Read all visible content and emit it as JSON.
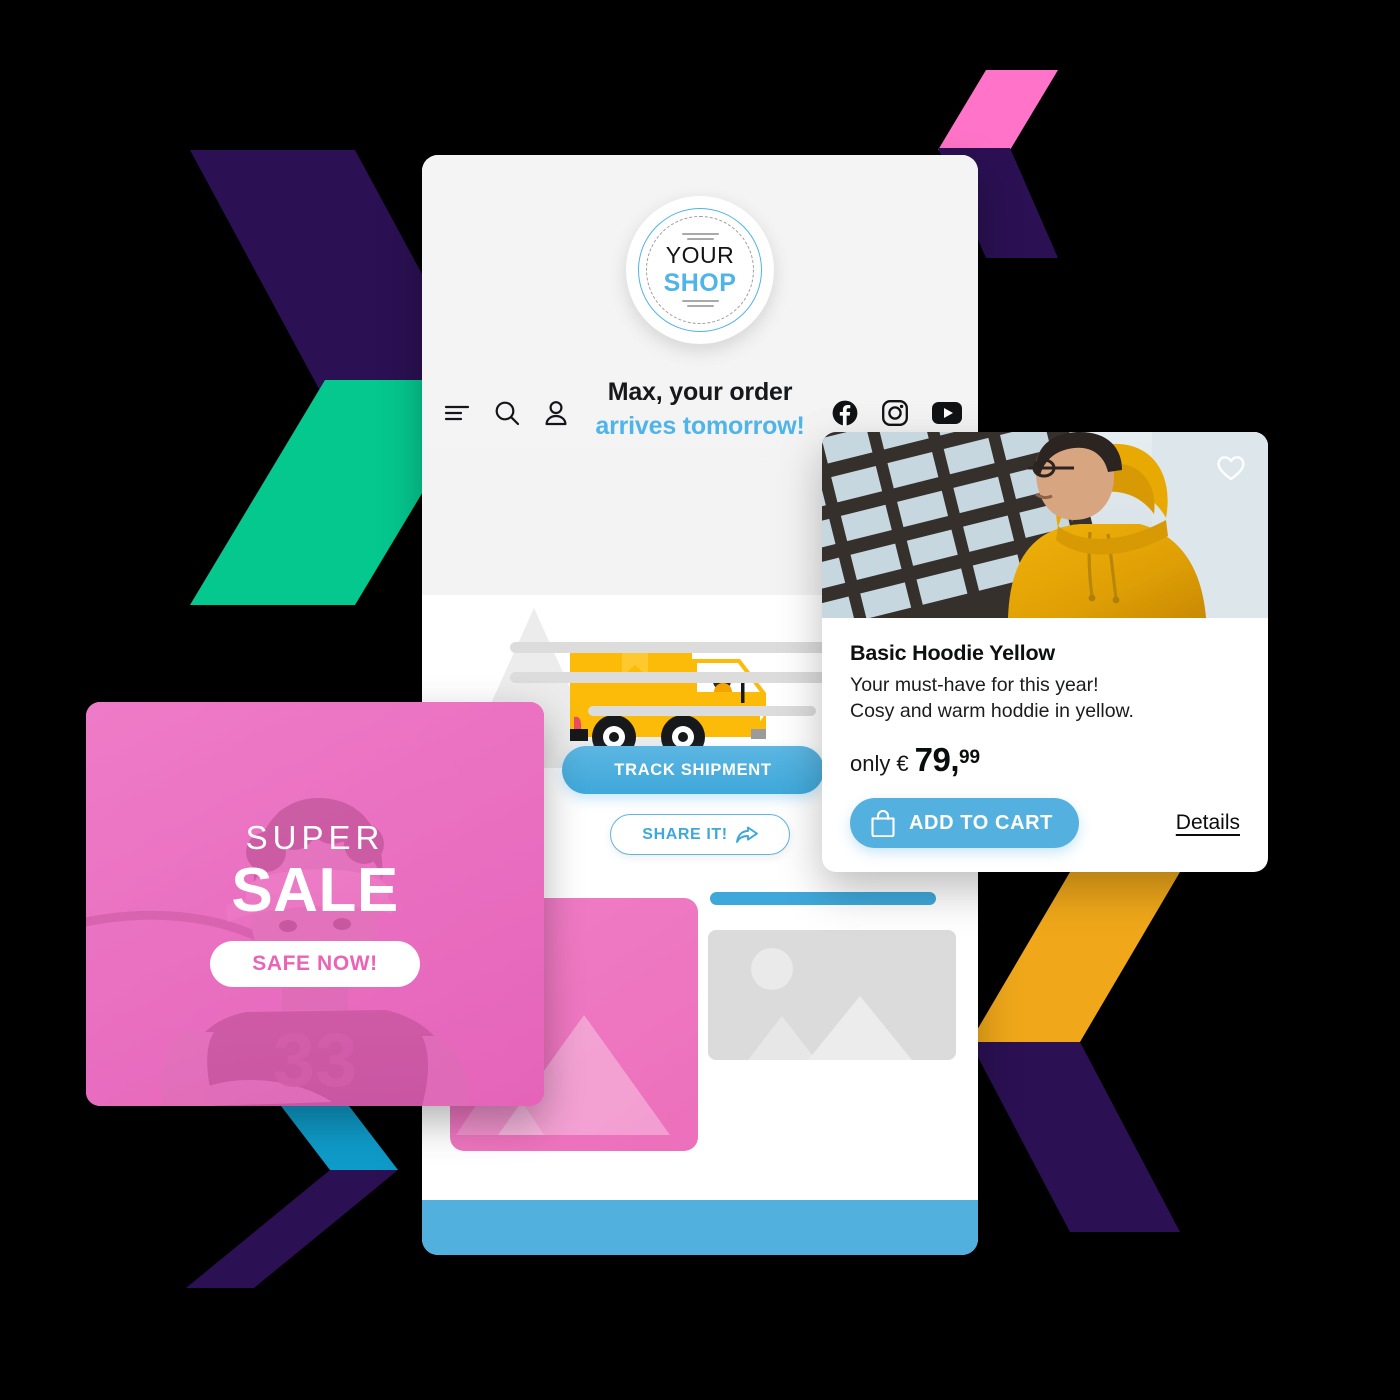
{
  "background": {
    "canvas_color": "#000000",
    "chevrons": [
      {
        "name": "chevron-purple-top-left",
        "color": "#2B1053"
      },
      {
        "name": "chevron-green-left",
        "color": "#05C88F"
      },
      {
        "name": "chevron-pink-top-right",
        "color": "#FF74C8"
      },
      {
        "name": "chevron-purple-top-right",
        "color": "#2B1053"
      },
      {
        "name": "chevron-yellow-bottom-right",
        "color": "#F0A81A"
      },
      {
        "name": "chevron-purple-bottom-right",
        "color": "#2B1053"
      },
      {
        "name": "chevron-blue-bottom-left",
        "color": "#0F9BC9"
      },
      {
        "name": "chevron-purple-bottom-left",
        "color": "#2B1053"
      }
    ]
  },
  "shop": {
    "logo": {
      "line1": "YOUR",
      "line2": "SHOP"
    },
    "nav_icons": [
      "menu-icon",
      "search-icon",
      "user-icon"
    ],
    "social_icons": [
      "facebook-icon",
      "instagram-icon",
      "youtube-icon"
    ],
    "headline": {
      "line1": "Max, your order",
      "line2": "arrives tomorrow!"
    },
    "buttons": {
      "track": "TRACK SHIPMENT",
      "share": "SHARE IT!"
    },
    "accent_blue": "#4FB4E8",
    "footer_blue": "#52B0DE"
  },
  "sale_card": {
    "eyebrow": "SUPER",
    "title": "SALE",
    "cta": "SAFE NOW!",
    "tint_color": "#EE74C4",
    "cta_text_color": "#EB63B4"
  },
  "product_card": {
    "title": "Basic Hoodie Yellow",
    "description_line1": "Your must-have for this year!",
    "description_line2": "Cosy and warm hoddie in yellow.",
    "price": {
      "prefix": "only",
      "currency": "€",
      "amount": "79,",
      "cents": "99"
    },
    "add_to_cart": "ADD TO CART",
    "details": "Details",
    "favourite_icon": "heart-icon",
    "cart_icon": "shopping-bag-icon",
    "button_color": "#54B1DF",
    "image_alt_color": "#E8A400"
  }
}
